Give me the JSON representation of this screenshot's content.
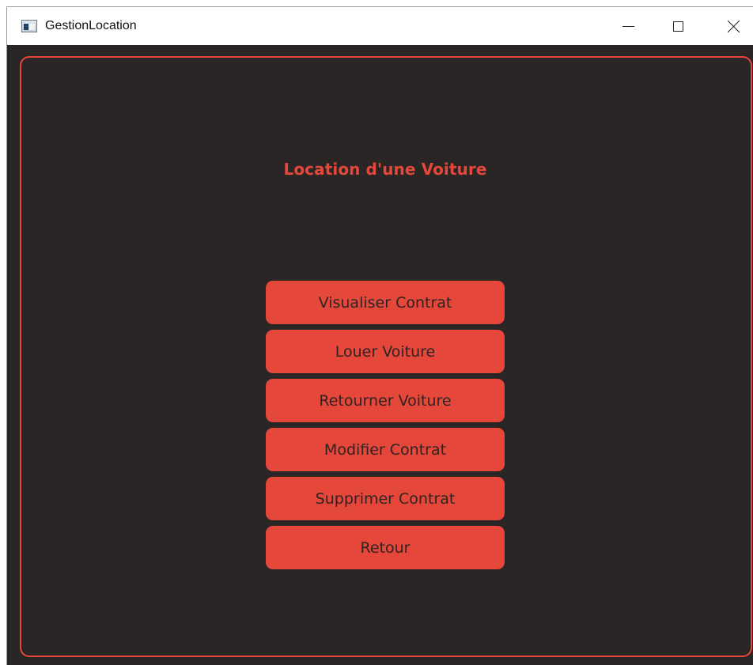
{
  "window": {
    "title": "GestionLocation",
    "controls": {
      "minimize": "minimize-icon",
      "maximize": "maximize-icon",
      "close": "close-icon"
    }
  },
  "main": {
    "heading": "Location d'une Voiture",
    "buttons": [
      {
        "label": "Visualiser Contrat"
      },
      {
        "label": "Louer Voiture"
      },
      {
        "label": "Retourner Voiture"
      },
      {
        "label": "Modifier Contrat"
      },
      {
        "label": "Supprimer Contrat"
      },
      {
        "label": "Retour"
      }
    ]
  },
  "colors": {
    "accent": "#e5473a",
    "background": "#2b2626",
    "button_text": "#2f2323"
  }
}
